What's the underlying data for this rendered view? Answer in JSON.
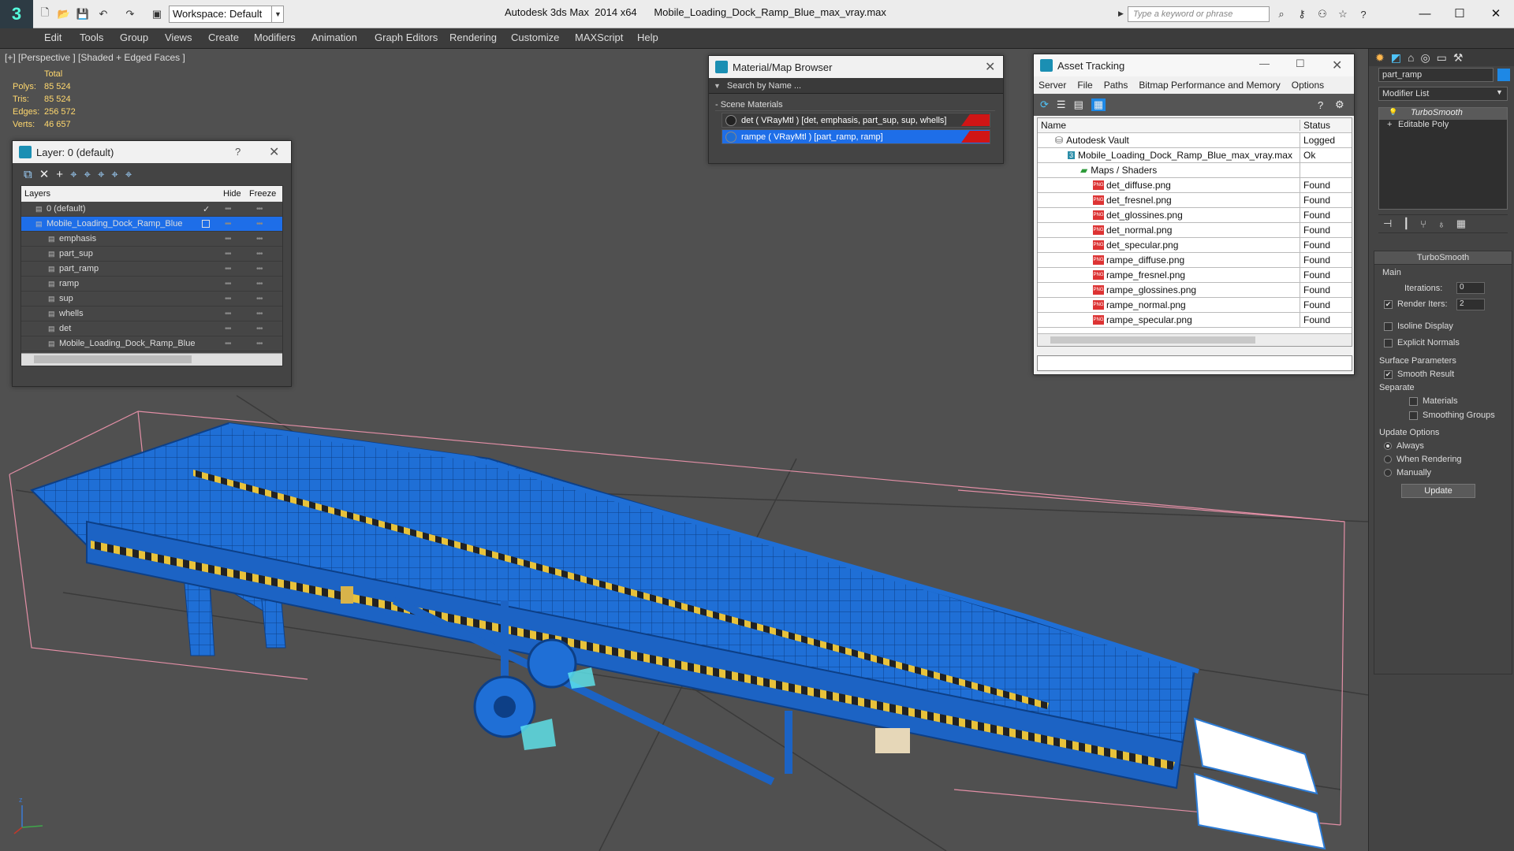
{
  "app": {
    "title": "Autodesk 3ds Max  2014 x64      Mobile_Loading_Dock_Ramp_Blue_max_vray.max",
    "workspace": "Workspace: Default",
    "search_placeholder": "Type a keyword or phrase",
    "accent": "#1f6fd6"
  },
  "menu": [
    "Edit",
    "Tools",
    "Group",
    "Views",
    "Create",
    "Modifiers",
    "Animation",
    "Graph Editors",
    "Rendering",
    "Customize",
    "MAXScript",
    "Help"
  ],
  "viewport": {
    "label": "[+] [Perspective ] [Shaded + Edged Faces ]",
    "stats": {
      "header": "Total",
      "rows": [
        {
          "label": "Polys:",
          "value": "85 524"
        },
        {
          "label": "Tris:",
          "value": "85 524"
        },
        {
          "label": "Edges:",
          "value": "256 572"
        },
        {
          "label": "Verts:",
          "value": "46 657"
        }
      ]
    }
  },
  "layers_panel": {
    "title": "Layer: 0 (default)",
    "help": "?",
    "columns": {
      "layers": "Layers",
      "hide": "Hide",
      "freeze": "Freeze"
    },
    "rows": [
      {
        "name": "0 (default)",
        "indent": 0,
        "selected": false
      },
      {
        "name": "Mobile_Loading_Dock_Ramp_Blue",
        "indent": 0,
        "selected": true
      },
      {
        "name": "emphasis",
        "indent": 1,
        "selected": false
      },
      {
        "name": "part_sup",
        "indent": 1,
        "selected": false
      },
      {
        "name": "part_ramp",
        "indent": 1,
        "selected": false
      },
      {
        "name": "ramp",
        "indent": 1,
        "selected": false
      },
      {
        "name": "sup",
        "indent": 1,
        "selected": false
      },
      {
        "name": "whells",
        "indent": 1,
        "selected": false
      },
      {
        "name": "det",
        "indent": 1,
        "selected": false
      },
      {
        "name": "Mobile_Loading_Dock_Ramp_Blue",
        "indent": 1,
        "selected": false
      }
    ]
  },
  "material_browser": {
    "title": "Material/Map Browser",
    "search_placeholder": "Search by Name ...",
    "section": "- Scene Materials",
    "items": [
      "det  ( VRayMtl )  [det, emphasis, part_sup, sup, whells]",
      "rampe  ( VRayMtl )  [part_ramp, ramp]"
    ]
  },
  "asset_tracking": {
    "title": "Asset Tracking",
    "menu": [
      "Server",
      "File",
      "Paths",
      "Bitmap Performance and Memory",
      "Options"
    ],
    "columns": {
      "name": "Name",
      "status": "Status"
    },
    "rows": [
      {
        "name": "Autodesk Vault",
        "status": "Logged Out",
        "indent": 0,
        "kind": "vault"
      },
      {
        "name": "Mobile_Loading_Dock_Ramp_Blue_max_vray.max",
        "status": "Ok",
        "indent": 1,
        "kind": "max"
      },
      {
        "name": "Maps / Shaders",
        "status": "",
        "indent": 2,
        "kind": "folder"
      },
      {
        "name": "det_diffuse.png",
        "status": "Found",
        "indent": 3,
        "kind": "png"
      },
      {
        "name": "det_fresnel.png",
        "status": "Found",
        "indent": 3,
        "kind": "png"
      },
      {
        "name": "det_glossines.png",
        "status": "Found",
        "indent": 3,
        "kind": "png"
      },
      {
        "name": "det_normal.png",
        "status": "Found",
        "indent": 3,
        "kind": "png"
      },
      {
        "name": "det_specular.png",
        "status": "Found",
        "indent": 3,
        "kind": "png"
      },
      {
        "name": "rampe_diffuse.png",
        "status": "Found",
        "indent": 3,
        "kind": "png"
      },
      {
        "name": "rampe_fresnel.png",
        "status": "Found",
        "indent": 3,
        "kind": "png"
      },
      {
        "name": "rampe_glossines.png",
        "status": "Found",
        "indent": 3,
        "kind": "png"
      },
      {
        "name": "rampe_normal.png",
        "status": "Found",
        "indent": 3,
        "kind": "png"
      },
      {
        "name": "rampe_specular.png",
        "status": "Found",
        "indent": 3,
        "kind": "png"
      }
    ]
  },
  "command_panel": {
    "object_name": "part_ramp",
    "modifier_list": "Modifier List",
    "stack": [
      "TurboSmooth",
      "Editable Poly"
    ],
    "turbosmooth": {
      "header": "TurboSmooth",
      "main": "Main",
      "iterations_label": "Iterations:",
      "iterations": "0",
      "render_iters_label": "Render Iters:",
      "render_iters": "2",
      "isoline": "Isoline Display",
      "explicit": "Explicit Normals",
      "surface": "Surface Parameters",
      "smooth": "Smooth Result",
      "separate": "Separate",
      "materials": "Materials",
      "smoothing_groups": "Smoothing Groups",
      "update_options": "Update Options",
      "always": "Always",
      "when_rendering": "When Rendering",
      "manually": "Manually",
      "update_button": "Update"
    }
  }
}
